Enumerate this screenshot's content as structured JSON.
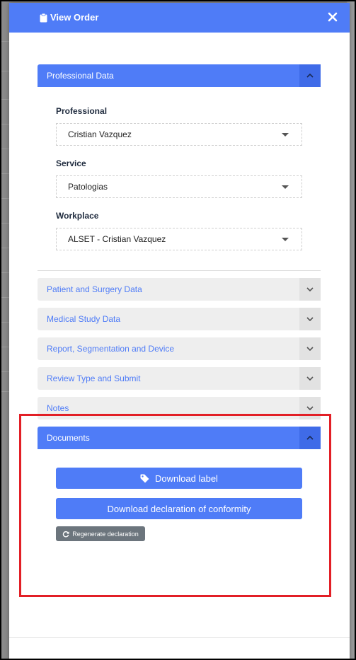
{
  "modal": {
    "title": "View Order",
    "close_icon": "close-icon",
    "header_icon": "clipboard-icon"
  },
  "colors": {
    "accent": "#4f7cf7",
    "secondary_button": "#6c757d",
    "highlight": "#e21f26"
  },
  "sections": {
    "professional_data": {
      "label": "Professional Data",
      "expanded": true
    },
    "patient_surgery": {
      "label": "Patient and Surgery Data",
      "expanded": false
    },
    "medical_study": {
      "label": "Medical Study Data",
      "expanded": false
    },
    "report_segmentation": {
      "label": "Report, Segmentation and Device",
      "expanded": false
    },
    "review_submit": {
      "label": "Review Type and Submit",
      "expanded": false
    },
    "notes": {
      "label": "Notes",
      "expanded": false
    },
    "documents": {
      "label": "Documents",
      "expanded": true
    }
  },
  "professional_form": {
    "professional_label": "Professional",
    "professional_value": "Cristian Vazquez",
    "service_label": "Service",
    "service_value": "Patologias",
    "workplace_label": "Workplace",
    "workplace_value": "ALSET - Cristian Vazquez"
  },
  "documents": {
    "download_label": "Download label",
    "download_declaration": "Download declaration of conformity",
    "regenerate_declaration": "Regenerate declaration"
  }
}
